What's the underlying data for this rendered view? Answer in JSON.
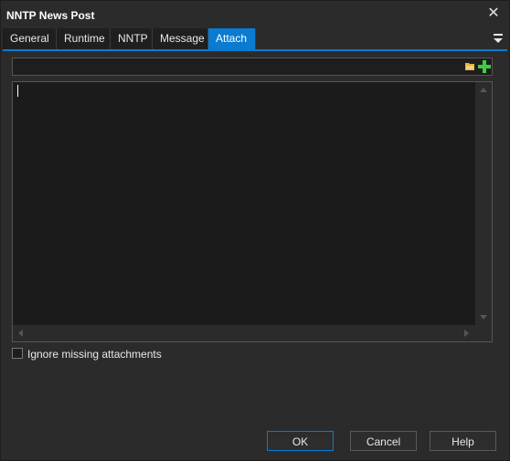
{
  "window": {
    "title": "NNTP News Post",
    "close_glyph": "✕"
  },
  "tabs": [
    {
      "label": "General"
    },
    {
      "label": "Runtime"
    },
    {
      "label": "NNTP"
    },
    {
      "label": "Message"
    },
    {
      "label": "Attach"
    }
  ],
  "active_tab": "Attach",
  "attach": {
    "path_value": "",
    "browse_icon": "folder-icon",
    "add_icon": "plus-icon",
    "list_text": "",
    "ignore_missing": {
      "label": "Ignore missing attachments",
      "checked": false
    }
  },
  "buttons": {
    "ok": "OK",
    "cancel": "Cancel",
    "help": "Help"
  },
  "colors": {
    "accent": "#0a7bd1",
    "background": "#2b2b2b",
    "field": "#1e1e1e",
    "add": "#3ccf3c",
    "folder": "#e8b43c"
  }
}
